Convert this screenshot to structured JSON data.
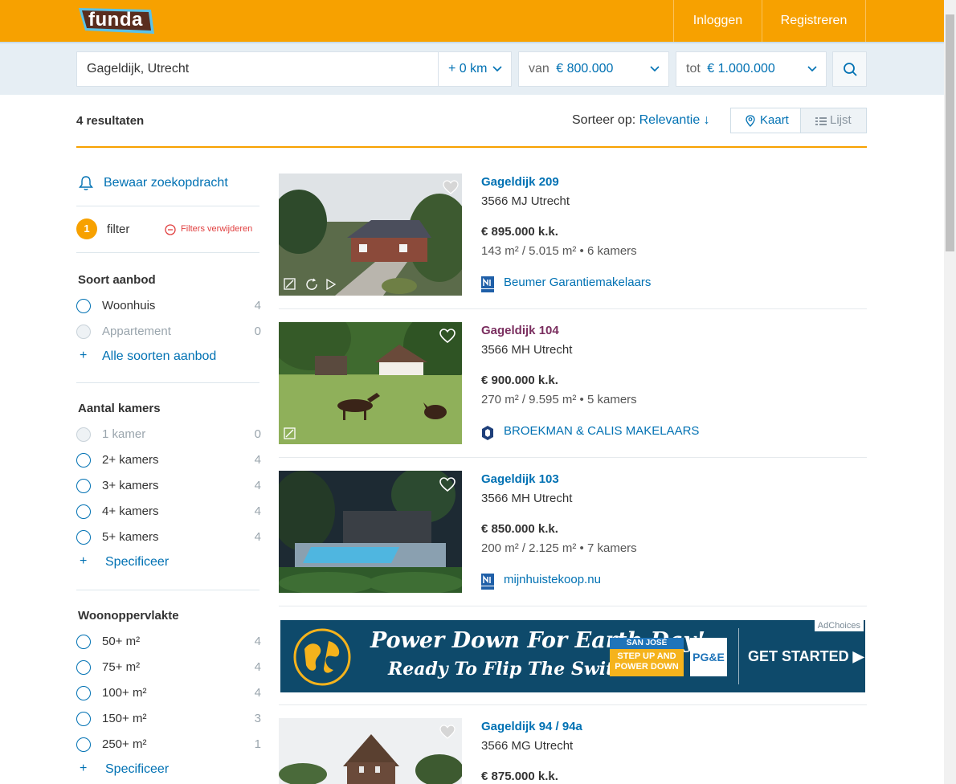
{
  "brand": {
    "logo_text": "funda",
    "accent": "#f7a100",
    "link": "#0071b3"
  },
  "header": {
    "login": "Inloggen",
    "register": "Registreren"
  },
  "search": {
    "location": "Gageldijk, Utrecht",
    "radius": "+ 0 km",
    "min_prefix": "van",
    "min_price": "€ 800.000",
    "max_prefix": "tot",
    "max_price": "€ 1.000.000"
  },
  "results": {
    "count_label": "4 resultaten",
    "sort_prefix": "Sorteer op:",
    "sort_value": "Relevantie ↓",
    "view_map": "Kaart",
    "view_list": "Lijst"
  },
  "sidebar": {
    "save_search": "Bewaar zoekopdracht",
    "filter_count": "1",
    "filter_label": "filter",
    "clear_filters": "Filters verwijderen",
    "sections": [
      {
        "title": "Soort aanbod",
        "options": [
          {
            "label": "Woonhuis",
            "count": "4"
          },
          {
            "label": "Appartement",
            "count": "0"
          }
        ],
        "more": "Alle soorten aanbod"
      },
      {
        "title": "Aantal kamers",
        "options": [
          {
            "label": "1 kamer",
            "count": "0"
          },
          {
            "label": "2+ kamers",
            "count": "4"
          },
          {
            "label": "3+ kamers",
            "count": "4"
          },
          {
            "label": "4+ kamers",
            "count": "4"
          },
          {
            "label": "5+ kamers",
            "count": "4"
          }
        ],
        "more": "Specificeer"
      },
      {
        "title": "Woonoppervlakte",
        "options": [
          {
            "label": "50+ m²",
            "count": "4"
          },
          {
            "label": "75+ m²",
            "count": "4"
          },
          {
            "label": "100+ m²",
            "count": "4"
          },
          {
            "label": "150+ m²",
            "count": "3"
          },
          {
            "label": "250+ m²",
            "count": "1"
          }
        ],
        "more": "Specificeer"
      }
    ]
  },
  "listings": [
    {
      "title": "Gageldijk 209",
      "address": "3566 MJ Utrecht",
      "price": "€ 895.000 k.k.",
      "specs": "143 m² / 5.015 m² • 6 kamers",
      "agent": "Beumer Garantiemakelaars"
    },
    {
      "title": "Gageldijk 104",
      "address": "3566 MH Utrecht",
      "price": "€ 900.000 k.k.",
      "specs": "270 m² / 9.595 m² • 5 kamers",
      "agent": "BROEKMAN & CALIS MAKELAARS"
    },
    {
      "title": "Gageldijk 103",
      "address": "3566 MH Utrecht",
      "price": "€ 850.000 k.k.",
      "specs": "200 m² / 2.125 m² • 7 kamers",
      "agent": "mijnhuistekoop.nu"
    },
    {
      "title": "Gageldijk 94 / 94a",
      "address": "3566 MG Utrecht",
      "price": "€ 875.000 k.k."
    }
  ],
  "ad": {
    "choices": "AdChoices",
    "line1": "Power Down For Earth Day!",
    "line2": "Ready To Flip The Switch?",
    "badge_top": "SAN JOSÉ",
    "badge_mid": "STEP UP AND",
    "badge_bot": "POWER DOWN",
    "logo": "PG&E",
    "cta": "GET STARTED ▶"
  }
}
